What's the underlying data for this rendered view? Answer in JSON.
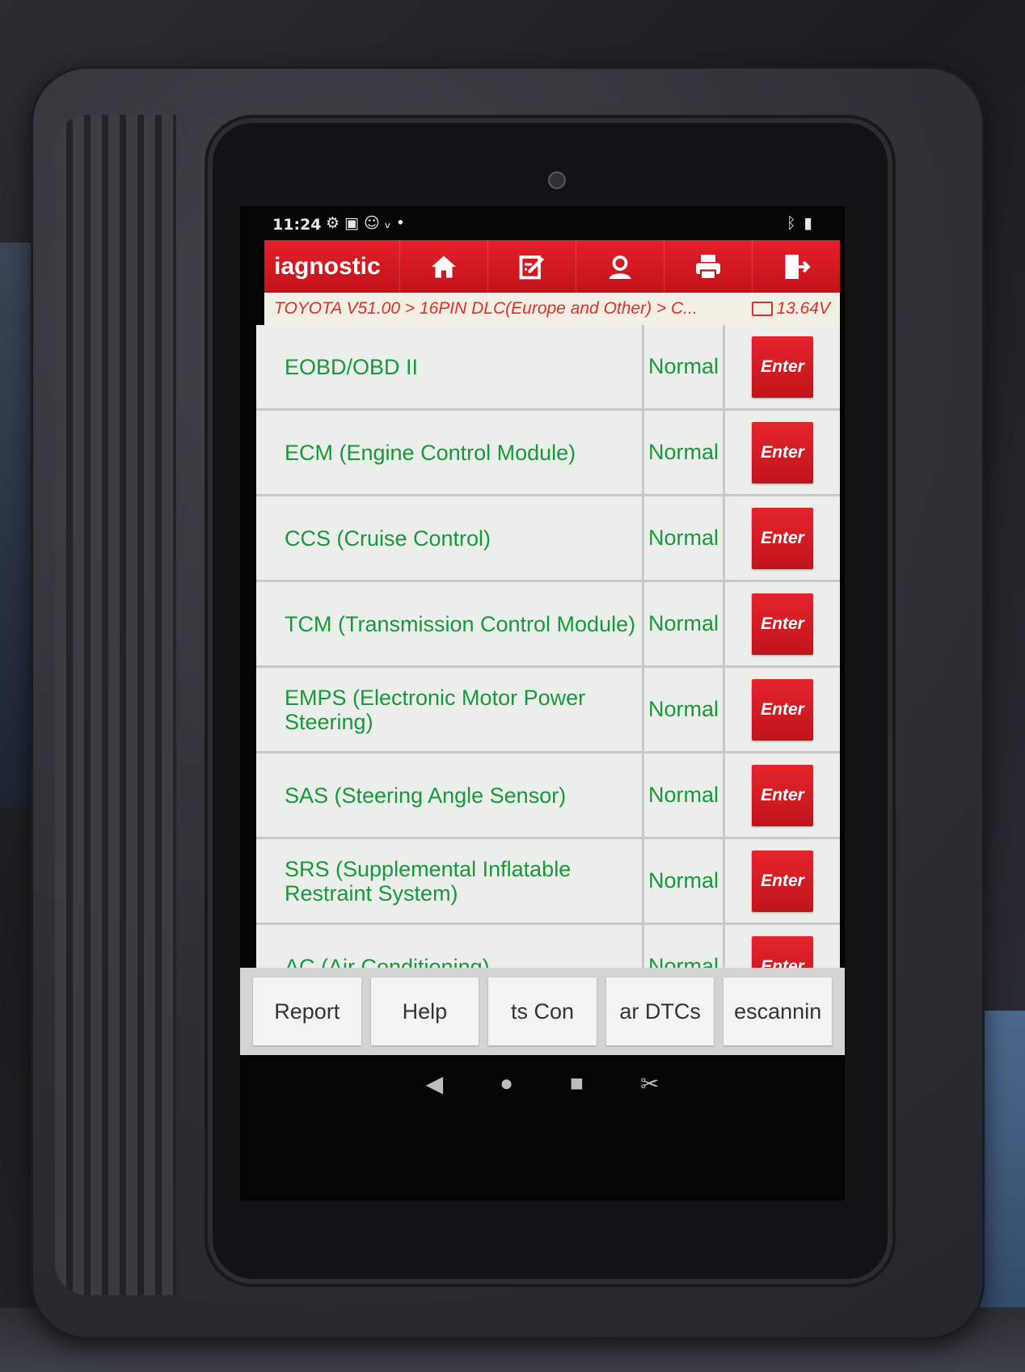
{
  "status_bar": {
    "time": "11:24",
    "left_icons": [
      "gear-icon",
      "image-icon",
      "accessibility-icon",
      "usb-icon",
      "dot-icon"
    ],
    "right_icons": [
      "bluetooth-icon",
      "battery-icon"
    ]
  },
  "app_bar": {
    "title": "iagnostic",
    "tools": [
      {
        "name": "home-icon"
      },
      {
        "name": "edit-icon"
      },
      {
        "name": "user-icon"
      },
      {
        "name": "print-icon"
      },
      {
        "name": "exit-icon"
      }
    ],
    "color": "#d9181f"
  },
  "breadcrumb": {
    "path": "TOYOTA V51.00 > 16PIN DLC(Europe and Other) > C...",
    "voltage": "13.64V"
  },
  "systems": [
    {
      "name": "EOBD/OBD II",
      "status": "Normal",
      "action": "Enter"
    },
    {
      "name": "ECM (Engine Control Module)",
      "status": "Normal",
      "action": "Enter"
    },
    {
      "name": "CCS (Cruise Control)",
      "status": "Normal",
      "action": "Enter"
    },
    {
      "name": "TCM (Transmission Control Module)",
      "status": "Normal",
      "action": "Enter"
    },
    {
      "name": "EMPS (Electronic Motor Power Steering)",
      "status": "Normal",
      "action": "Enter"
    },
    {
      "name": "SAS (Steering Angle Sensor)",
      "status": "Normal",
      "action": "Enter"
    },
    {
      "name": "SRS (Supplemental Inflatable Restraint System)",
      "status": "Normal",
      "action": "Enter"
    },
    {
      "name": "AC (Air Conditioning)",
      "status": "Normal",
      "action": "Enter"
    }
  ],
  "bottom_buttons": [
    "Report",
    "Help",
    "ts    Con",
    "ar DTCs",
    "escannin"
  ],
  "nav": {
    "back_icon": "back-triangle-icon",
    "home_icon": "home-circle-icon",
    "recents_icon": "recents-square-icon",
    "screenshot_icon": "screenshot-icon"
  },
  "colors": {
    "status_green": "#17983a",
    "enter_red": "#d9181f",
    "breadcrumb_red": "#d8332b"
  }
}
